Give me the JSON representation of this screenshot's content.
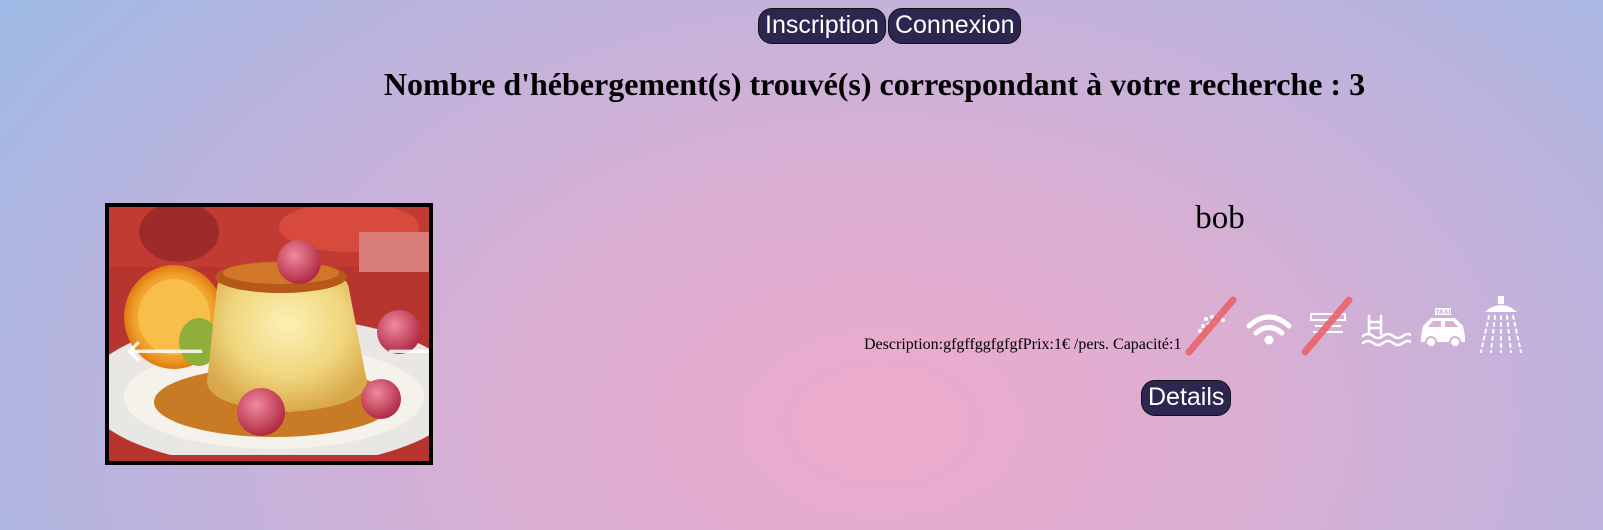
{
  "nav": {
    "inscription": "Inscription",
    "connexion": "Connexion"
  },
  "results": {
    "heading": "Nombre d'hébergement(s) trouvé(s) correspondant à votre recherche : 3"
  },
  "listing": {
    "name": "bob",
    "description_label": "Description:",
    "description_value": "gfgffggfgfgf",
    "price_label": "Prix:",
    "price_value": "1€ /pers.",
    "capacity_label": "Capacité:",
    "capacity_value": "1",
    "details_label": "Details",
    "carousel": {
      "prev_arrow": "🡐",
      "next_arrow": "🡒"
    },
    "amenities": [
      {
        "icon": "jacuzzi-icon",
        "available": false
      },
      {
        "icon": "wifi-icon",
        "available": true
      },
      {
        "icon": "air-conditioning-icon",
        "available": false
      },
      {
        "icon": "pool-icon",
        "available": true
      },
      {
        "icon": "taxi-icon",
        "available": true
      },
      {
        "icon": "shower-icon",
        "available": true
      }
    ]
  },
  "colors": {
    "button_bg": "#2c2650",
    "button_text": "#ffffff",
    "unavailable_slash": "#e8646b",
    "icon_white": "#ffffff"
  }
}
